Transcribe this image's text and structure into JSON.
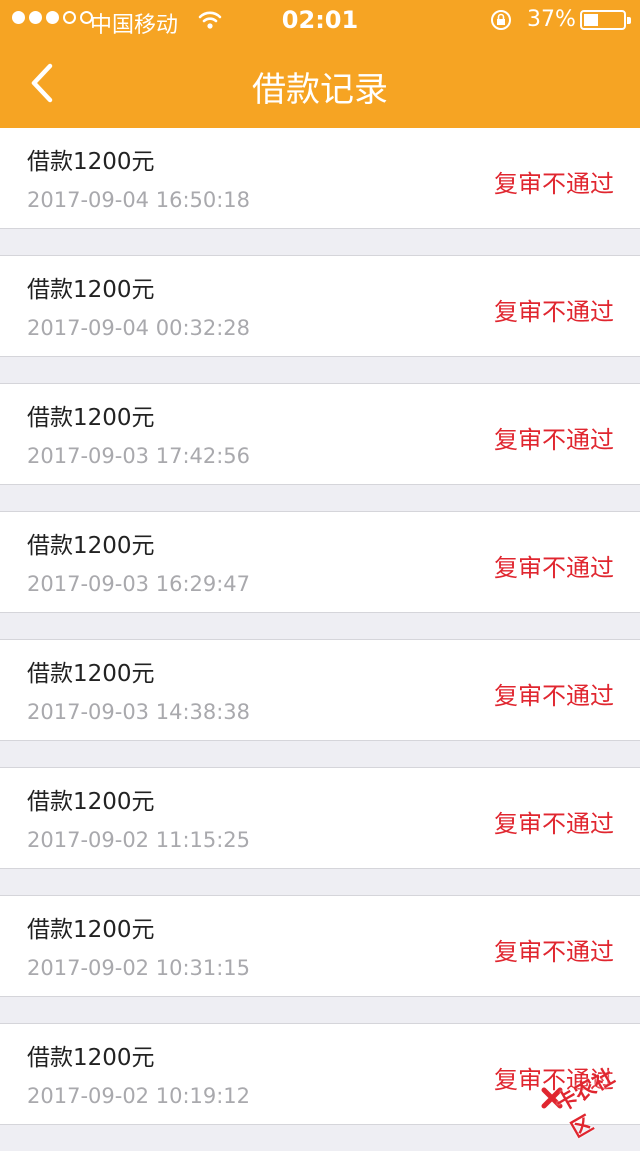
{
  "status_bar": {
    "carrier": "中国移动",
    "time": "02:01",
    "battery": "37%",
    "battery_level": 0.37
  },
  "nav": {
    "title": "借款记录"
  },
  "records": [
    {
      "title": "借款1200元",
      "time": "2017-09-04 16:50:18",
      "status": "复审不通过"
    },
    {
      "title": "借款1200元",
      "time": "2017-09-04 00:32:28",
      "status": "复审不通过"
    },
    {
      "title": "借款1200元",
      "time": "2017-09-03 17:42:56",
      "status": "复审不通过"
    },
    {
      "title": "借款1200元",
      "time": "2017-09-03 16:29:47",
      "status": "复审不通过"
    },
    {
      "title": "借款1200元",
      "time": "2017-09-03 14:38:38",
      "status": "复审不通过"
    },
    {
      "title": "借款1200元",
      "time": "2017-09-02 11:15:25",
      "status": "复审不通过"
    },
    {
      "title": "借款1200元",
      "time": "2017-09-02 10:31:15",
      "status": "复审不通过"
    },
    {
      "title": "借款1200元",
      "time": "2017-09-02 10:19:12",
      "status": "复审不通过"
    }
  ],
  "watermark": {
    "text": "卡农社区"
  },
  "colors": {
    "header": "#f6a423",
    "status_rejected": "#e0262f",
    "timestamp": "#a9a9ad"
  }
}
